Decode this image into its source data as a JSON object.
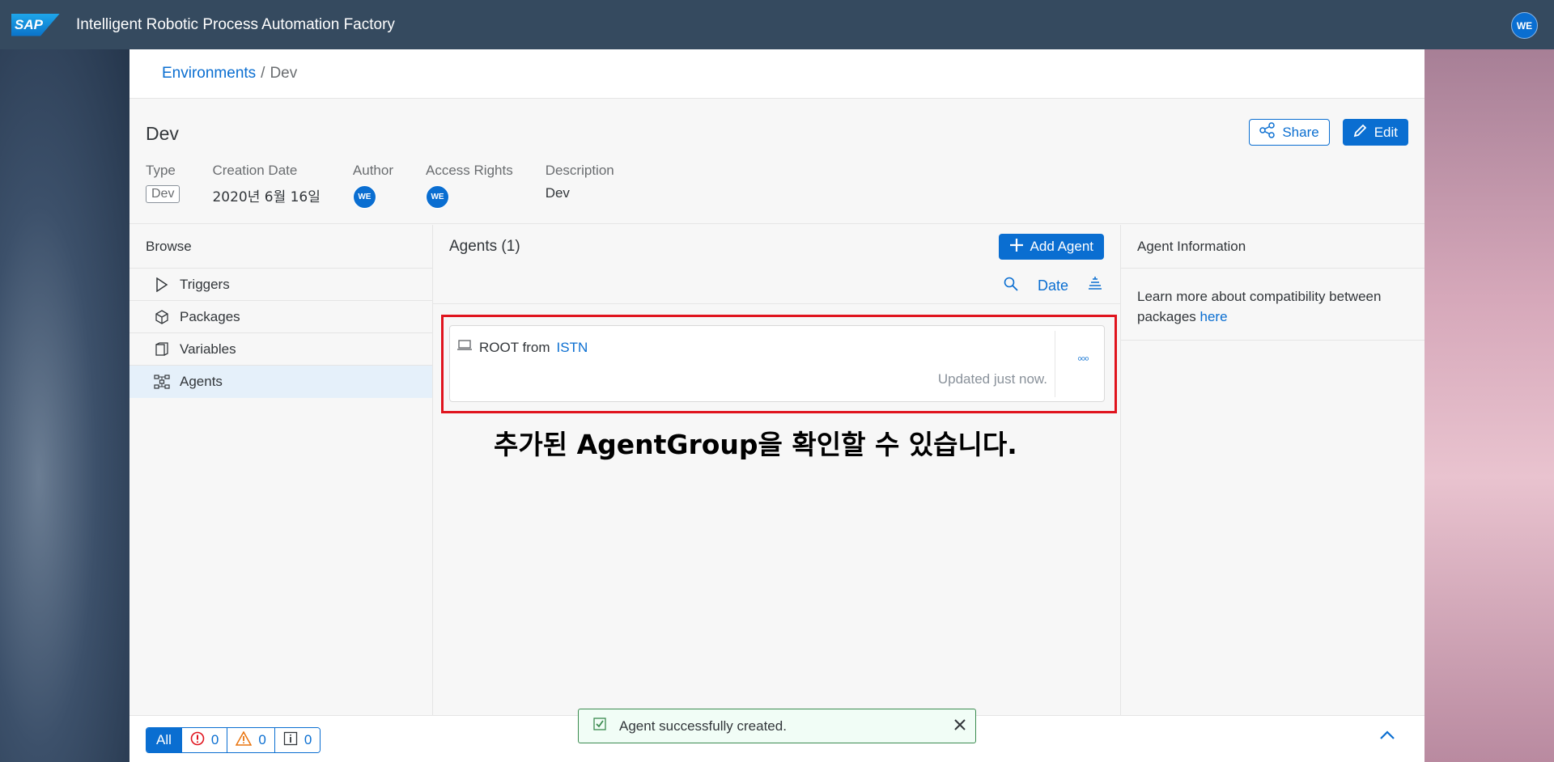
{
  "shell": {
    "logo_text": "SAP",
    "title": "Intelligent Robotic Process Automation Factory",
    "user_initials": "WE"
  },
  "breadcrumb": {
    "parent": "Environments",
    "separator": "/",
    "current": "Dev"
  },
  "header": {
    "title": "Dev",
    "share_label": "Share",
    "edit_label": "Edit",
    "attributes": {
      "type_label": "Type",
      "type_value": "Dev",
      "creation_label": "Creation Date",
      "creation_value": "2020년 6월 16일",
      "author_label": "Author",
      "author_initials": "WE",
      "access_label": "Access Rights",
      "access_initials": "WE",
      "description_label": "Description",
      "description_value": "Dev"
    }
  },
  "browse": {
    "title": "Browse",
    "items": [
      {
        "label": "Triggers",
        "icon": "play-icon"
      },
      {
        "label": "Packages",
        "icon": "package-icon"
      },
      {
        "label": "Variables",
        "icon": "variables-icon"
      },
      {
        "label": "Agents",
        "icon": "agents-icon",
        "selected": true
      }
    ]
  },
  "agents": {
    "title": "Agents (1)",
    "add_label": "Add Agent",
    "sort_label": "Date",
    "card": {
      "name_prefix": "ROOT from",
      "name_link": "ISTN",
      "updated": "Updated just now.",
      "more": "◦◦◦"
    },
    "annotation": "추가된 AgentGroup을 확인할 수 있습니다."
  },
  "info": {
    "title": "Agent Information",
    "text": "Learn more about compatibility between packages",
    "link": "here"
  },
  "footer": {
    "all_label": "All",
    "errors": "0",
    "warnings": "0",
    "infos": "0"
  },
  "toast": {
    "message": "Agent successfully created."
  },
  "colors": {
    "shell": "#354a5f",
    "accent": "#0a6ed1",
    "highlight": "#e0141e",
    "success_bg": "#f1fdf6"
  }
}
